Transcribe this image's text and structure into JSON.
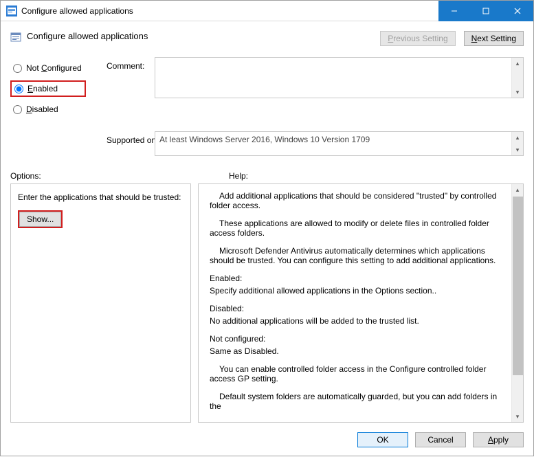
{
  "window": {
    "title": "Configure allowed applications"
  },
  "header": {
    "title": "Configure allowed applications",
    "prev_setting": "Previous Setting",
    "next_setting": "Next Setting"
  },
  "state_radios": {
    "not_configured": "Not Configured",
    "enabled": "Enabled",
    "disabled": "Disabled",
    "selected": "enabled"
  },
  "labels": {
    "comment": "Comment:",
    "supported_on": "Supported on:",
    "options": "Options:",
    "help": "Help:"
  },
  "comment": "",
  "supported_on": "At least Windows Server 2016, Windows 10 Version 1709",
  "options_pane": {
    "enter_label": "Enter the applications that should be trusted:",
    "show_button": "Show..."
  },
  "help_text": {
    "p1": "Add additional applications that should be considered \"trusted\" by controlled folder access.",
    "p2": "These applications are allowed to modify or delete files in controlled folder access folders.",
    "p3": "Microsoft Defender Antivirus automatically determines which applications should be trusted. You can configure this setting to add additional applications.",
    "p4a": "Enabled:",
    "p4b": "Specify additional allowed applications in the Options section..",
    "p5a": "Disabled:",
    "p5b": "No additional applications will be added to the trusted list.",
    "p6a": "Not configured:",
    "p6b": "Same as Disabled.",
    "p7": "You can enable controlled folder access in the Configure controlled folder access GP setting.",
    "p8": "Default system folders are automatically guarded, but you can add folders in the"
  },
  "footer": {
    "ok": "OK",
    "cancel": "Cancel",
    "apply": "Apply"
  }
}
